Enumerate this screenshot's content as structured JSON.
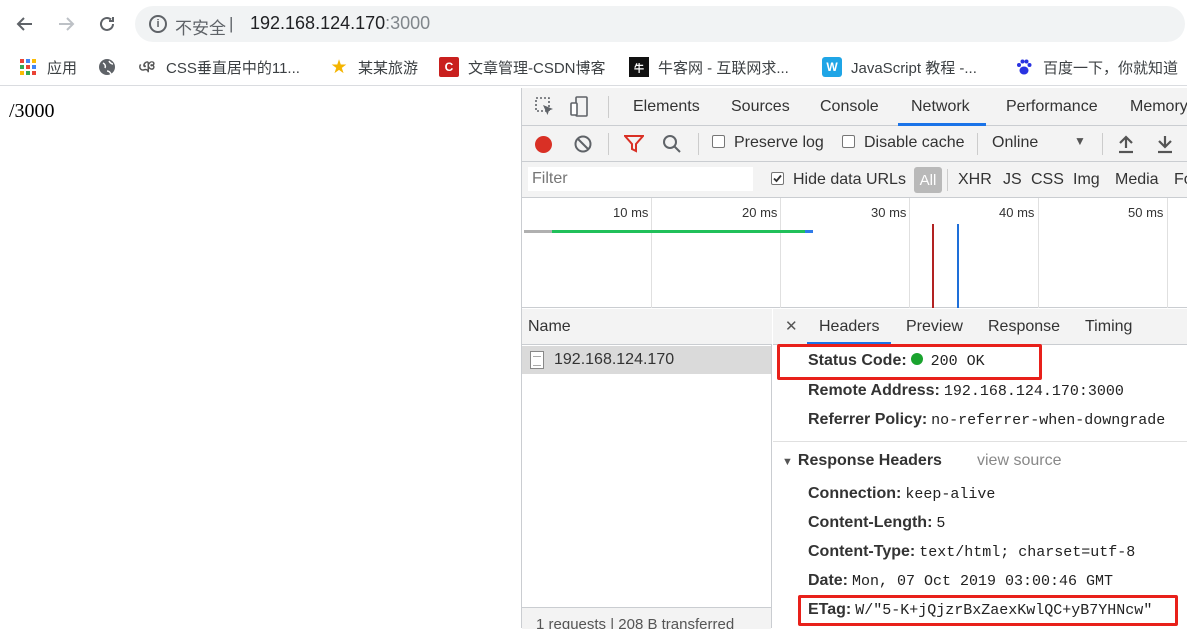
{
  "browser": {
    "insecure_label": "不安全",
    "separator": "|",
    "host": "192.168.124.170",
    "port": ":3000",
    "bookmarks": [
      {
        "label": "应用",
        "icon": "apps-grid-icon"
      },
      {
        "label": "",
        "icon": "globe-icon"
      },
      {
        "label": "CSS垂直居中的11...",
        "icon": "swirl-icon"
      },
      {
        "label": "某某旅游",
        "icon": "star-icon"
      },
      {
        "label": "文章管理-CSDN博客",
        "icon": "csdn-icon"
      },
      {
        "label": "牛客网 - 互联网求...",
        "icon": "nowcoder-icon"
      },
      {
        "label": "JavaScript 教程 -...",
        "icon": "w-icon"
      },
      {
        "label": "百度一下，你就知道",
        "icon": "baidu-paw-icon"
      }
    ]
  },
  "page": {
    "text": "/3000"
  },
  "devtools": {
    "tabs": [
      "Elements",
      "Sources",
      "Console",
      "Network",
      "Performance",
      "Memory"
    ],
    "active_tab": "Network",
    "network_bar": {
      "preserve_log": "Preserve log",
      "disable_cache": "Disable cache",
      "throttle": "Online"
    },
    "filter": {
      "placeholder": "Filter",
      "hide_data_urls": "Hide data URLs",
      "types": [
        "All",
        "XHR",
        "JS",
        "CSS",
        "Img",
        "Media",
        "Fo"
      ]
    },
    "timeline_labels": [
      "10 ms",
      "20 ms",
      "30 ms",
      "40 ms",
      "50 ms"
    ],
    "requests": {
      "header": "Name",
      "rows": [
        "192.168.124.170"
      ],
      "summary": "1 requests | 208 B transferred"
    },
    "detail": {
      "tabs": [
        "Headers",
        "Preview",
        "Response",
        "Timing"
      ],
      "general": [
        {
          "key": "Status Code:",
          "value": "200 OK"
        },
        {
          "key": "Remote Address:",
          "value": "192.168.124.170:3000"
        },
        {
          "key": "Referrer Policy:",
          "value": "no-referrer-when-downgrade"
        }
      ],
      "response_headers_title": "Response Headers",
      "view_source": "view source",
      "response_headers": [
        {
          "key": "Connection:",
          "value": "keep-alive"
        },
        {
          "key": "Content-Length:",
          "value": "5"
        },
        {
          "key": "Content-Type:",
          "value": "text/html; charset=utf-8"
        },
        {
          "key": "Date:",
          "value": "Mon, 07 Oct 2019 03:00:46 GMT"
        },
        {
          "key": "ETag:",
          "value": "W/\"5-K+jQjzrBxZaexKwlQC+yB7YHNcw\""
        }
      ]
    }
  },
  "colors": {
    "accent": "#1a73e8",
    "highlight": "#e8201a",
    "status_ok": "#1aa32e"
  }
}
